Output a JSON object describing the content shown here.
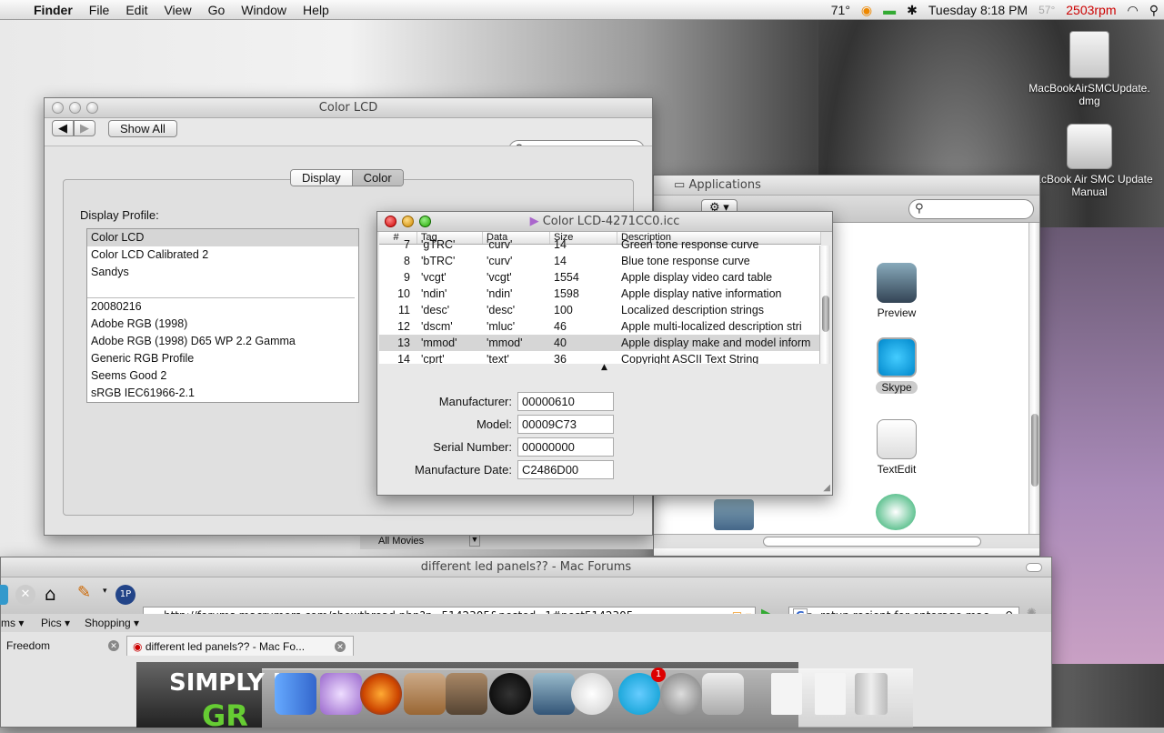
{
  "menubar": {
    "app": "Finder",
    "menus": [
      "File",
      "Edit",
      "View",
      "Go",
      "Window",
      "Help"
    ],
    "temp": "71°",
    "datetime": "Tuesday 8:18 PM",
    "fan_temp": "57°",
    "fan_rpm": "2503rpm"
  },
  "desktop": {
    "icons": [
      {
        "label": "MacBookAirSMCUpdate.dmg",
        "icon": "disk-image-icon"
      },
      {
        "label": "MacBook Air SMC Update Manual",
        "icon": "hard-drive-icon"
      }
    ]
  },
  "color_lcd_window": {
    "title": "Color LCD",
    "show_all": "Show All",
    "search_placeholder": "",
    "tabs": [
      "Display",
      "Color"
    ],
    "selected_tab": "Color",
    "profile_label": "Display Profile:",
    "profiles_top": [
      "Color LCD",
      "Color LCD Calibrated 2",
      "Sandys"
    ],
    "profiles_bottom": [
      "20080216",
      "Adobe RGB (1998)",
      "Adobe RGB (1998) D65 WP 2.2 Gamma",
      "Generic RGB Profile",
      "Seems Good 2",
      "sRGB IEC61966-2.1"
    ],
    "selected_profile": "Color LCD"
  },
  "applications_window": {
    "title": "Applications",
    "apps": [
      "Preview",
      "Skype",
      "TextEdit"
    ],
    "sidebar_item": "All Movies"
  },
  "icc_window": {
    "title": "Color LCD-4271CC0.icc",
    "columns": [
      "#",
      "Tag",
      "Data",
      "Size",
      "Description"
    ],
    "rows": [
      {
        "n": "7",
        "tag": "'gTRC'",
        "data": "'curv'",
        "size": "14",
        "desc": "Green tone response curve"
      },
      {
        "n": "8",
        "tag": "'bTRC'",
        "data": "'curv'",
        "size": "14",
        "desc": "Blue tone response curve"
      },
      {
        "n": "9",
        "tag": "'vcgt'",
        "data": "'vcgt'",
        "size": "1554",
        "desc": "Apple display video card table"
      },
      {
        "n": "10",
        "tag": "'ndin'",
        "data": "'ndin'",
        "size": "1598",
        "desc": "Apple display native information"
      },
      {
        "n": "11",
        "tag": "'desc'",
        "data": "'desc'",
        "size": "100",
        "desc": "Localized description strings"
      },
      {
        "n": "12",
        "tag": "'dscm'",
        "data": "'mluc'",
        "size": "46",
        "desc": "Apple multi-localized description stri"
      },
      {
        "n": "13",
        "tag": "'mmod'",
        "data": "'mmod'",
        "size": "40",
        "desc": "Apple display make and model inform"
      },
      {
        "n": "14",
        "tag": "'cprt'",
        "data": "'text'",
        "size": "36",
        "desc": "Copyright ASCII Text String"
      }
    ],
    "selected_row": "13",
    "fields": [
      {
        "label": "Manufacturer:",
        "value": "00000610"
      },
      {
        "label": "Model:",
        "value": "00009C73"
      },
      {
        "label": "Serial Number:",
        "value": "00000000"
      },
      {
        "label": "Manufacture Date:",
        "value": "C2486D00"
      }
    ]
  },
  "browser": {
    "title": "different led panels?? - Mac Forums",
    "url": "http://forums.macrumors.com/showthread.php?p=5142305&posted=1#post5142305",
    "search_text": "retun reciept for entorage mac",
    "bookmarks": [
      "ms ▾",
      "Pics ▾",
      "Shopping ▾"
    ],
    "tabs": [
      "Freedom",
      "different led panels?? - Mac Fo..."
    ],
    "page_banner": "SIMPLY U",
    "page_banner2": "GR"
  },
  "dock": {
    "apps": [
      "Finder",
      "Safari",
      "Firefox",
      "Address Book",
      "iPhoto",
      "Image Capture",
      "Dashboard",
      "Preview",
      "Skype",
      "System Preferences",
      "Social",
      "Document",
      "RTF",
      "Trash"
    ],
    "skype_badge": "1"
  }
}
